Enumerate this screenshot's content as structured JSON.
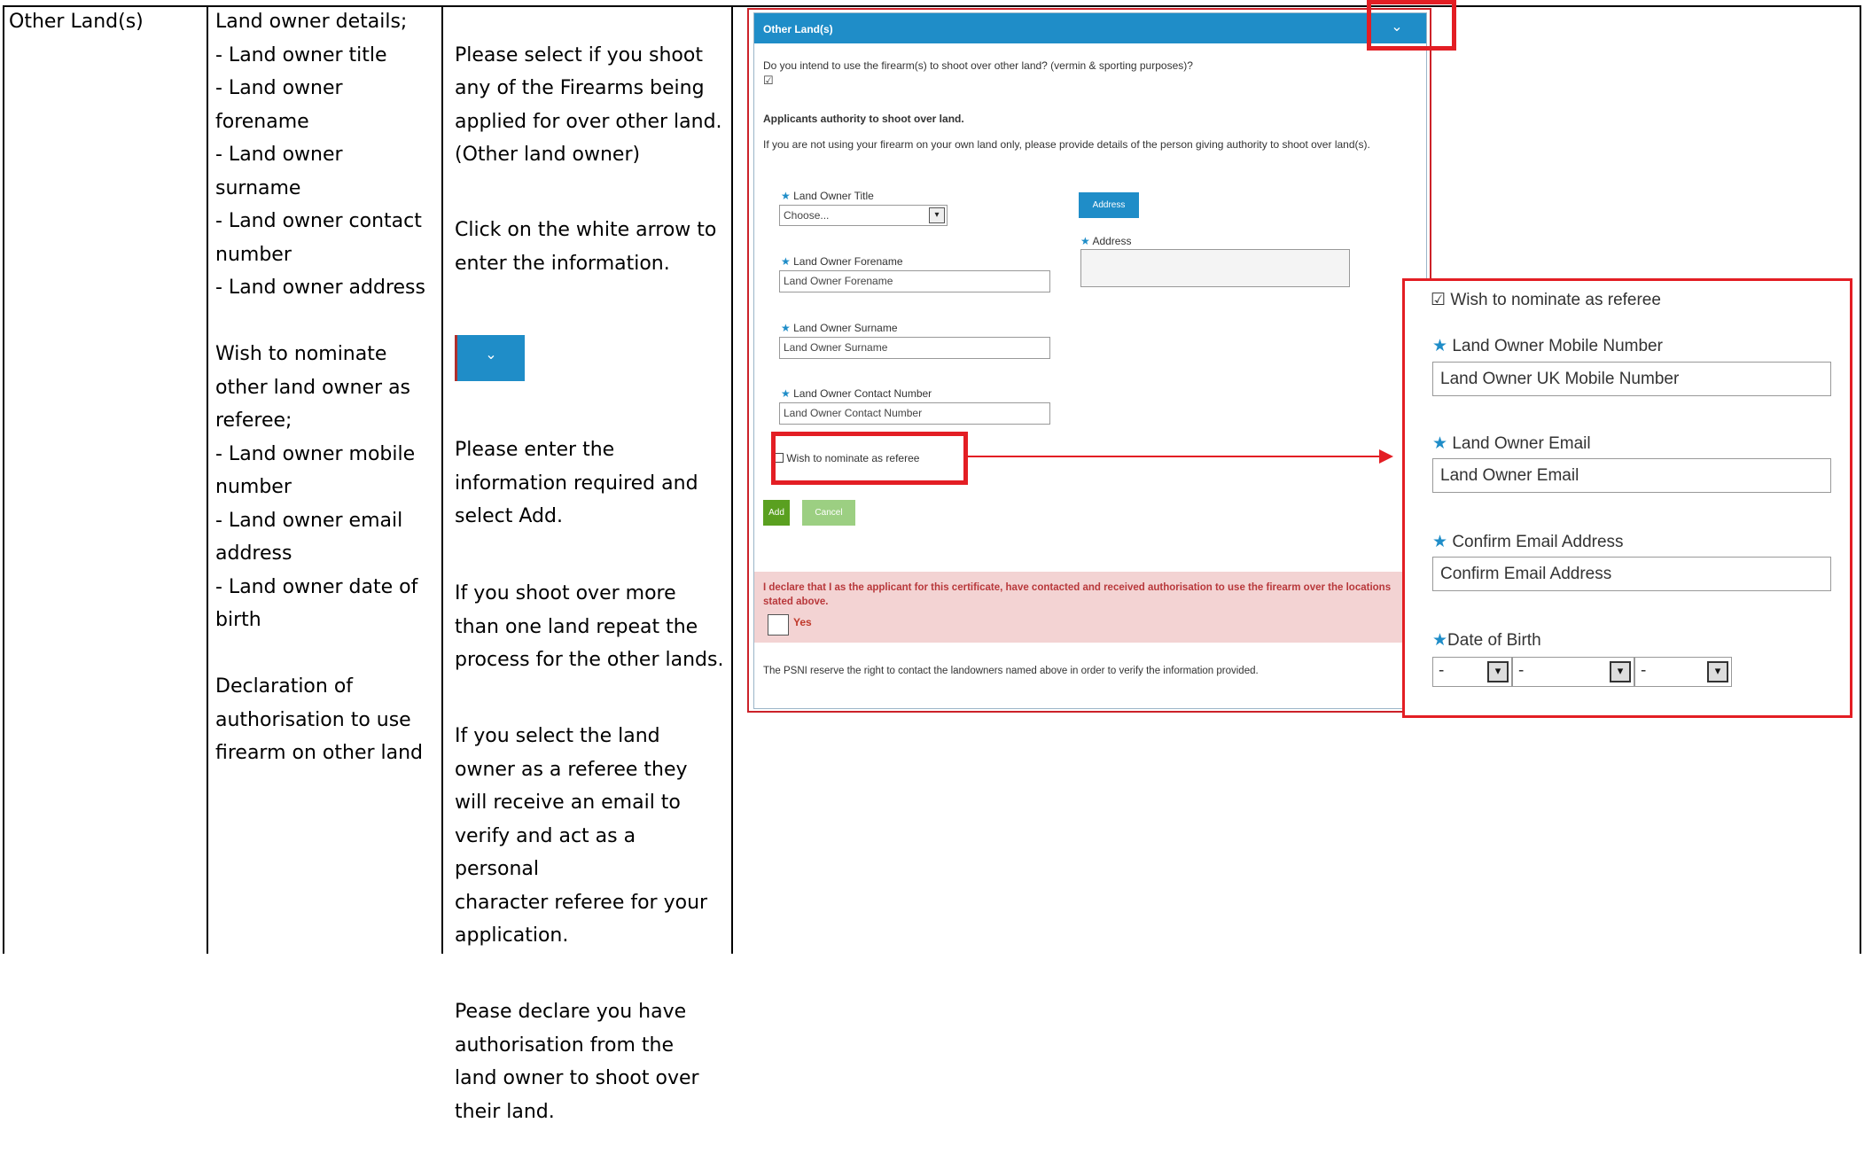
{
  "row": {
    "field": "Other Land(s)",
    "details": [
      "Land owner details;",
      " - Land owner title",
      " - Land owner",
      "forename",
      " - Land owner",
      "surname",
      " - Land owner contact",
      "number",
      " - Land owner address",
      "",
      "Wish to nominate",
      "other land owner as",
      "referee;",
      " - Land owner mobile",
      "number",
      " - Land owner email",
      "address",
      " - Land owner date of",
      "birth",
      "",
      "Declaration of",
      "authorisation to use",
      "firearm on other land"
    ],
    "instructions": {
      "p1": "Please select if you shoot\nany of the Firearms being\napplied for over other land.\n(Other land owner)",
      "p2": "Click on the white arrow to\nenter the information.",
      "p3": "Please enter the\ninformation required and\nselect Add.",
      "p4": "If you shoot over more\nthan one land repeat the\nprocess for the other lands.",
      "p5": "If you select the land\nowner as a referee they\nwill receive an email to\nverify and act as a personal\ncharacter referee for your\napplication.",
      "p6": "Pease declare you have\nauthorisation from the\nland owner to shoot over\ntheir land."
    }
  },
  "form": {
    "header": "Other Land(s)",
    "question": "Do you intend to use the firearm(s) to shoot over other land? (vermin & sporting purposes)?",
    "question_checkbox": "☑",
    "authority_title": "Applicants authority to shoot over land.",
    "authority_text": "If you are not using your firearm on your own land only, please provide details of the person giving authority to shoot over land(s).",
    "title_label": "Land Owner Title",
    "title_value": "Choose...",
    "address_button": "Address",
    "address_label": "Address",
    "forename_label": "Land Owner Forename",
    "forename_placeholder": "Land Owner Forename",
    "surname_label": "Land Owner Surname",
    "surname_placeholder": "Land Owner Surname",
    "contact_label": "Land Owner Contact Number",
    "contact_placeholder": "Land Owner Contact Number",
    "referee_checkbox_label": "Wish to nominate as referee",
    "add_button": "Add",
    "cancel_button": "Cancel",
    "declaration": "I declare that I as the applicant for this certificate, have contacted and received authorisation to use the firearm over the locations stated above.",
    "declaration_yes": "Yes",
    "psni_note": "The PSNI reserve the right to contact the landowners named above in order to verify the information provided."
  },
  "referee_zoom": {
    "checkbox_label": "Wish to nominate as referee",
    "mobile_label": "Land Owner Mobile Number",
    "mobile_placeholder": "Land Owner UK Mobile Number",
    "email_label": "Land Owner Email",
    "email_placeholder": "Land Owner Email",
    "confirm_label": "Confirm Email Address",
    "confirm_placeholder": "Confirm Email Address",
    "dob_label": "Date of Birth",
    "dob_day": "-",
    "dob_month": "-",
    "dob_year": "-"
  },
  "colors": {
    "accent_blue": "#1f8dc8",
    "highlight_red": "#e31e24",
    "add_green": "#5aa020"
  }
}
